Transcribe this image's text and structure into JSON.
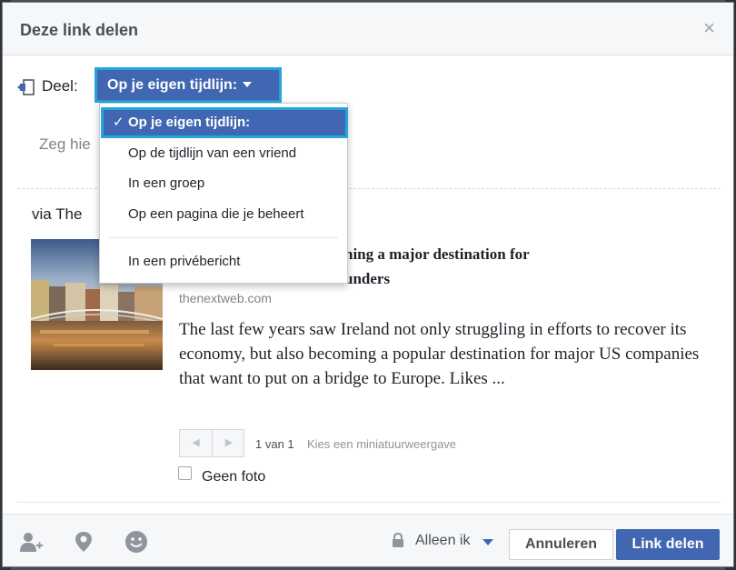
{
  "dialog": {
    "title": "Deze link delen",
    "close_symbol": "×"
  },
  "share": {
    "label": "Deel:",
    "selected": "Op je eigen tijdlijn:"
  },
  "menu": {
    "items": [
      "Op je eigen tijdlijn:",
      "Op de tijdlijn van een vriend",
      "In een groep",
      "Op een pagina die je beheert",
      "In een privébericht"
    ],
    "check_symbol": "✓"
  },
  "composer": {
    "placeholder_visible": "Zeg hie"
  },
  "post": {
    "via": "via The",
    "title_line1": "ning a major destination for",
    "title_line2": "unders",
    "domain": "thenextweb.com",
    "description": "The last few years saw Ireland not only struggling in efforts to recover its economy, but also becoming a popular destination for major US companies that want to put on a bridge to Europe. Likes ...",
    "pager_count": "1 van 1",
    "pager_hint": "Kies een miniatuurweergave",
    "no_photo_label": "Geen foto",
    "no_photo_checked": false
  },
  "footer": {
    "privacy_label": "Alleen ik",
    "cancel_label": "Annuleren",
    "share_label": "Link delen"
  },
  "colors": {
    "accent": "#4267b2",
    "highlight": "#23a5dd"
  },
  "icons": [
    "share-icon",
    "add-friend-icon",
    "location-icon",
    "smiley-icon",
    "lock-icon",
    "chevron-down-icon",
    "close-icon",
    "check-icon",
    "arrow-left-icon",
    "arrow-right-icon"
  ]
}
